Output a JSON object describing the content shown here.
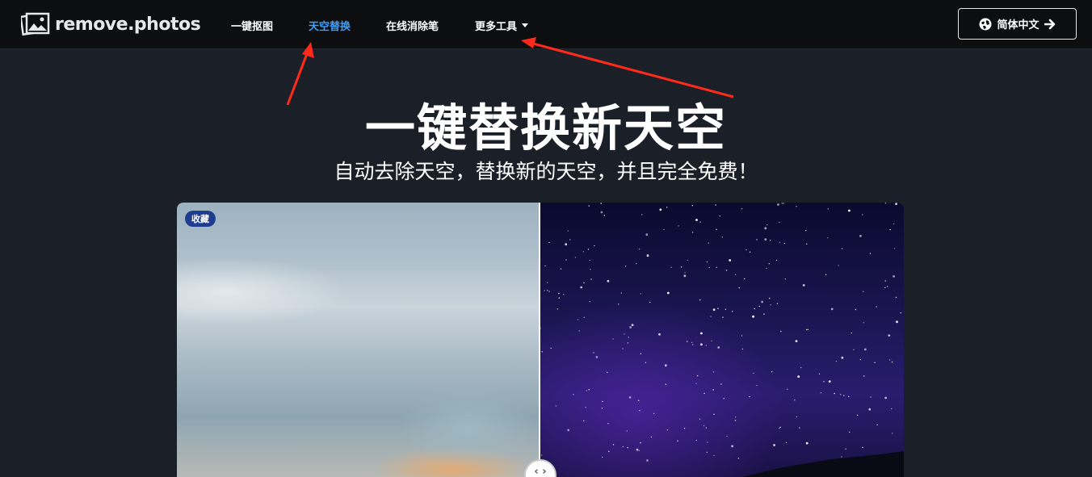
{
  "header": {
    "logo_text": "remove.photos",
    "logo_icon": "photos-icon",
    "nav": [
      {
        "label": "一键抠图",
        "active": false
      },
      {
        "label": "天空替换",
        "active": true
      },
      {
        "label": "在线消除笔",
        "active": false
      },
      {
        "label": "更多工具",
        "active": false,
        "dropdown": true
      }
    ],
    "language_button": {
      "label": "简体中文",
      "icon": "globe-icon",
      "arrow_icon": "arrow-right-icon"
    }
  },
  "hero": {
    "title": "一键替换新天空",
    "subtitle": "自动去除天空，替换新的天空，并且完全免费！"
  },
  "compare": {
    "favorite_badge": "收藏",
    "handle_icon": "chevrons-left-right-icon"
  },
  "colors": {
    "nav_active": "#3aa0ff",
    "annotation_arrow": "#ff2a1a",
    "badge_bg": "#1e3d8f",
    "page_bg": "#1b1f27",
    "topbar_bg": "#0d0e10"
  }
}
